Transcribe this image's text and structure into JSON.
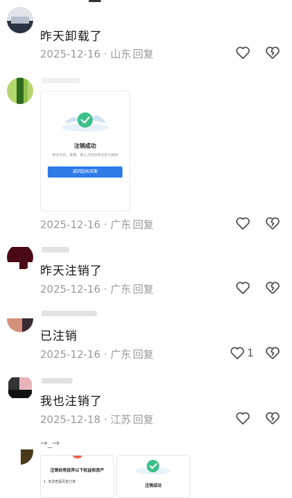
{
  "comments": [
    {
      "text": "昨天卸载了",
      "meta": "2025-12-16 · 山东",
      "reply": "回复",
      "likes": ""
    },
    {
      "text": "",
      "meta": "2025-12-16 · 广东",
      "reply": "回复",
      "likes": "",
      "card": {
        "title": "注销成功",
        "desc": "绑定手机、邮箱、第三方授权等关系已解绑",
        "button": "返回起始页面"
      }
    },
    {
      "text": "昨天注销了",
      "meta": "2025-12-16 · 广东",
      "reply": "回复",
      "likes": ""
    },
    {
      "text": "已注销",
      "meta": "2025-12-16 · 广东",
      "reply": "回复",
      "likes": "1"
    },
    {
      "text": "我也注销了",
      "meta": "2025-12-18 · 江苏",
      "reply": "回复",
      "likes": ""
    }
  ],
  "last_comment": {
    "name_fragment": "→_→",
    "card_a": {
      "title": "注销后将放弃以下权益和资产",
      "item": "1. 无法查看历史订单"
    },
    "card_b": {
      "title": "注销成功"
    }
  },
  "icons": {
    "like": "heart-outline-icon",
    "dislike": "broken-heart-icon"
  },
  "colors": {
    "meta": "#9a9a9a",
    "button": "#2f7ce8",
    "check": "#3cc08a"
  }
}
